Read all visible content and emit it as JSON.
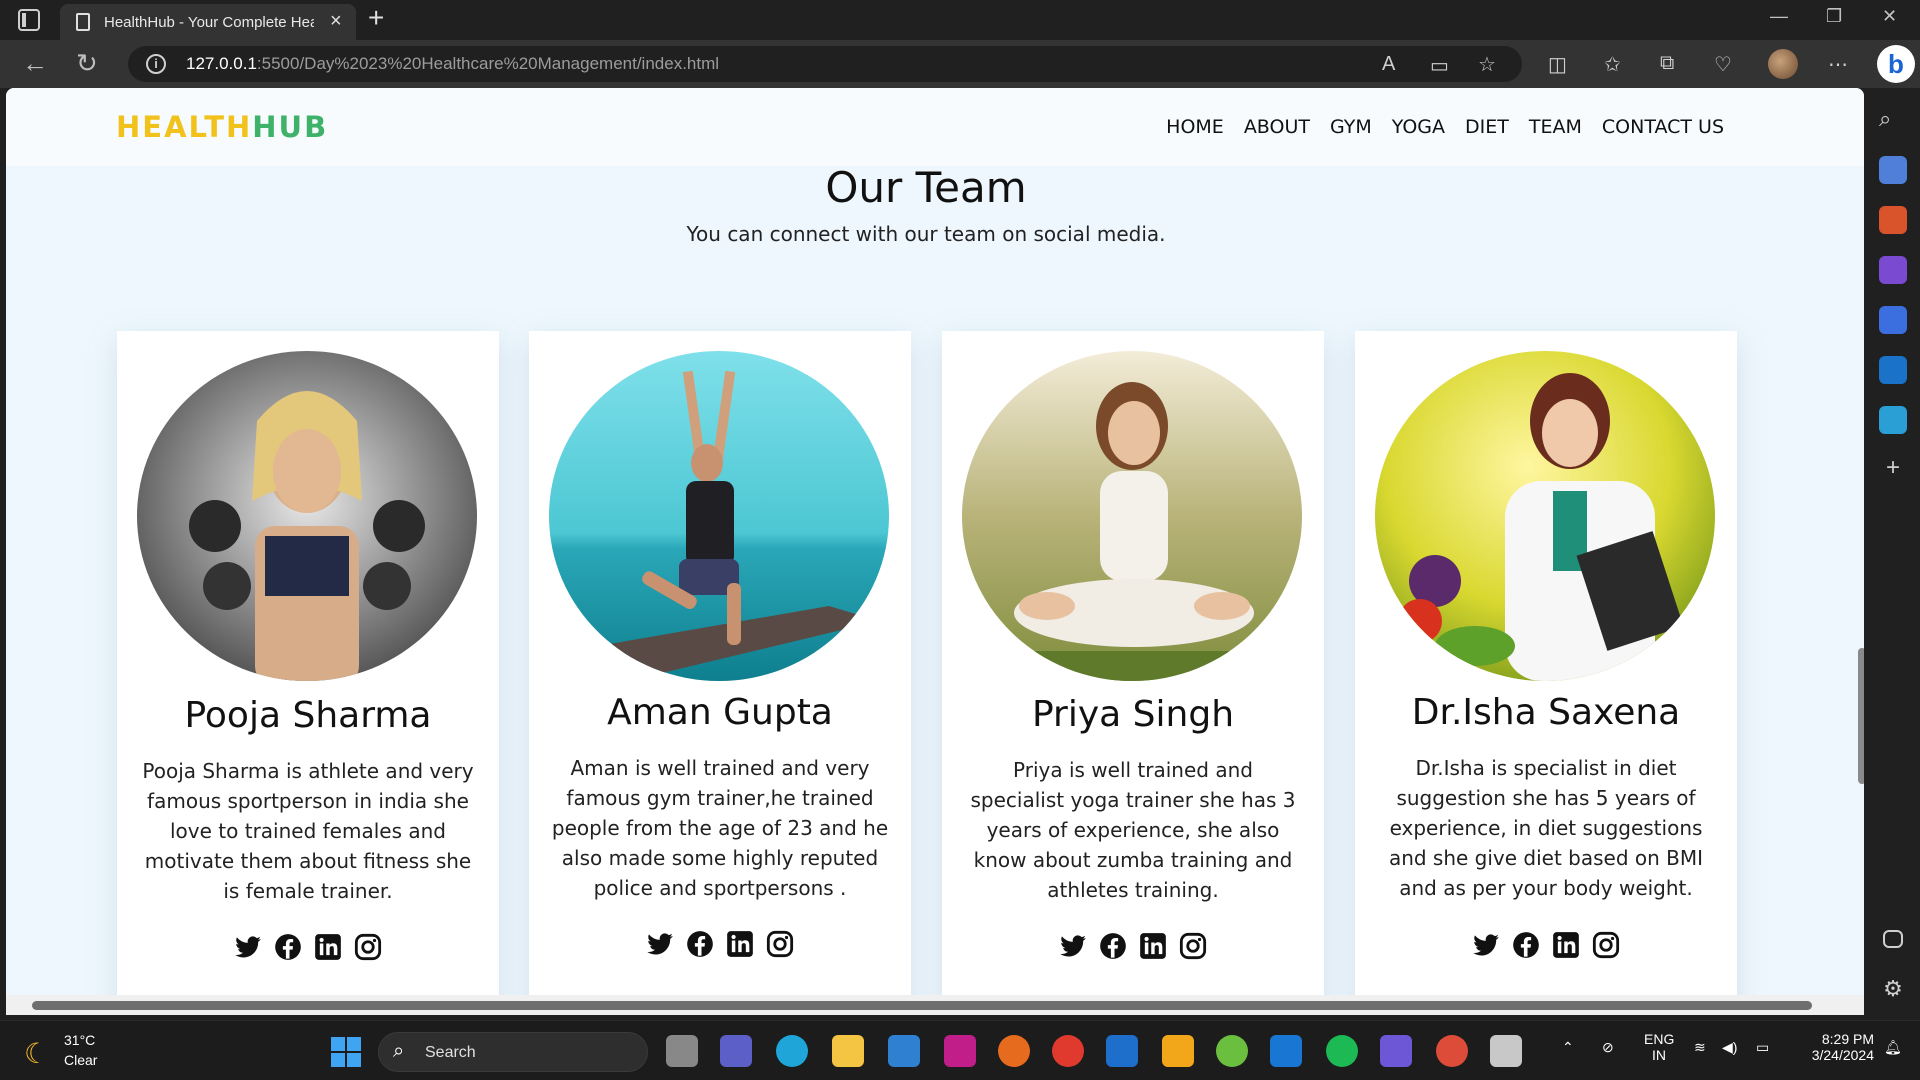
{
  "browser": {
    "tab_title": "HealthHub - Your Complete Heal",
    "url_host": "127.0.0.1",
    "url_rest": ":5500/Day%2023%20Healthcare%20Management/index.html"
  },
  "site": {
    "logo_part1": "HEALTH",
    "logo_part2": "HUB",
    "nav": [
      "HOME",
      "ABOUT",
      "GYM",
      "YOGA",
      "DIET",
      "TEAM",
      "CONTACT US"
    ],
    "section_title": "Our Team",
    "section_subtitle": "You can connect with our team on social media."
  },
  "team": [
    {
      "name": "Pooja Sharma",
      "bio": "Pooja Sharma is athlete and very famous sportperson in india she love to trained females and motivate them about fitness she is female trainer.",
      "photo_desc": "photo-fitness-woman-dumbbells"
    },
    {
      "name": "Aman Gupta",
      "bio": "Aman is well trained and very famous gym trainer,he trained people from the age of 23 and he also made some highly reputed police and sportpersons .",
      "photo_desc": "photo-man-yoga-pose"
    },
    {
      "name": "Priya Singh",
      "bio": "Priya is well trained and specialist yoga trainer she has 3 years of experience, she also know about zumba training and athletes training.",
      "photo_desc": "photo-woman-meditation"
    },
    {
      "name": "Dr.Isha Saxena",
      "bio": "Dr.Isha is specialist in diet suggestion she has 5 years of experience, in diet suggestions and she give diet based on BMI and as per your body weight.",
      "photo_desc": "photo-doctor-with-vegetables"
    }
  ],
  "social_icons": [
    "twitter-icon",
    "facebook-icon",
    "linkedin-icon",
    "instagram-icon"
  ],
  "taskbar": {
    "temperature": "31°C",
    "condition": "Clear",
    "search_label": "Search",
    "lang": "ENG",
    "region": "IN",
    "time": "8:29 PM",
    "date": "3/24/2024"
  },
  "colors": {
    "logo_yellow": "#f1c21b",
    "logo_green": "#3fb26a",
    "page_bg": "#eef7fd"
  }
}
